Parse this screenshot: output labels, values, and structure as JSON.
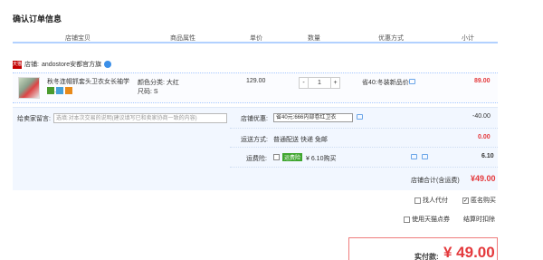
{
  "page_title": "确认订单信息",
  "columns": [
    "店铺宝贝",
    "商品属性",
    "单价",
    "数量",
    "优惠方式",
    "小计"
  ],
  "shop": {
    "icon_text": "天猫",
    "label": "店铺:",
    "name": "andostore安都官方旗"
  },
  "item": {
    "title_line1": "秋冬连帽抓套头卫衣女长袖学生...",
    "attr_color": "颜色分类: 大红",
    "attr_size": "尺码: S",
    "price": "129.00",
    "qty_minus": "-",
    "qty": "1",
    "qty_plus": "+",
    "discount": "省40:冬装新品价",
    "subtotal": "89.00"
  },
  "panel": {
    "message_label": "给卖家留言:",
    "message_placeholder": "选填:对本次交易的说明(建议填写已和卖家协商一致的内容)",
    "shop_discount_label": "店铺优惠:",
    "shop_discount_value": "省40元:666内部卷红卫衣",
    "shop_discount_amount": "-40.00",
    "shipping_label": "运送方式:",
    "shipping_value": "普通配送 快递 免邮",
    "shipping_amount": "0.00",
    "insurance_label": "运费险:",
    "insurance_tag": "运费险",
    "insurance_value": "¥ 6.10购买",
    "insurance_amount": "6.10",
    "shop_total_label": "店铺合计(含运费)",
    "shop_total_value": "¥49.00"
  },
  "options": {
    "proxy_pay": "找人代付",
    "anonymous": "匿名购买",
    "tmall_points": "使用天猫点券",
    "settle": "结算时扣除"
  },
  "payment": {
    "label": "实付款:",
    "amount": "¥ 49.00"
  }
}
